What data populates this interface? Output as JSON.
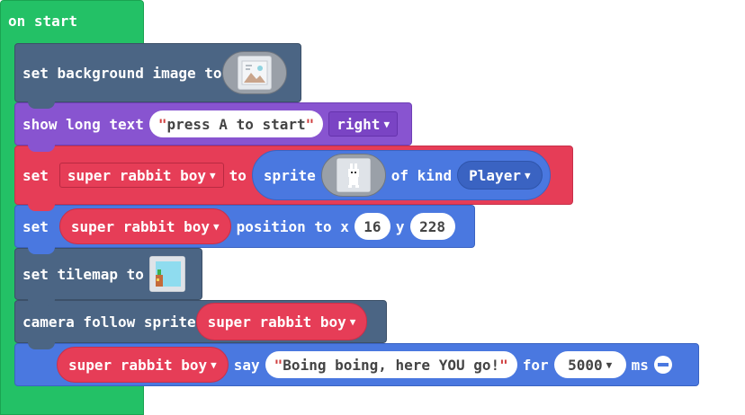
{
  "hat": {
    "label": "on start"
  },
  "blocks": {
    "set_bg": {
      "prefix": "set background image to",
      "icon": "image-placeholder-icon"
    },
    "show_text": {
      "prefix": "show long text",
      "text": "press A to start",
      "align": "right"
    },
    "set_sprite": {
      "prefix": "set",
      "variable": "super rabbit boy",
      "to": "to",
      "sprite": "sprite",
      "of_kind": "of kind",
      "kind": "Player"
    },
    "set_pos": {
      "prefix": "set",
      "variable": "super rabbit boy",
      "mid": "position to x",
      "x": "16",
      "y_label": "y",
      "y": "228"
    },
    "set_tilemap": {
      "prefix": "set tilemap to",
      "icon": "tilemap-icon"
    },
    "camera": {
      "prefix": "camera follow sprite",
      "variable": "super rabbit boy"
    },
    "say": {
      "variable": "super rabbit boy",
      "say": "say",
      "text": "Boing boing, here YOU go!",
      "for": "for",
      "ms_value": "5000",
      "ms": "ms"
    }
  },
  "colors": {
    "hat": "#23c166",
    "scene": "#4b6584",
    "text": "#8854d0",
    "sprites": "#e63d57",
    "sprites_blue": "#4a78e0"
  }
}
